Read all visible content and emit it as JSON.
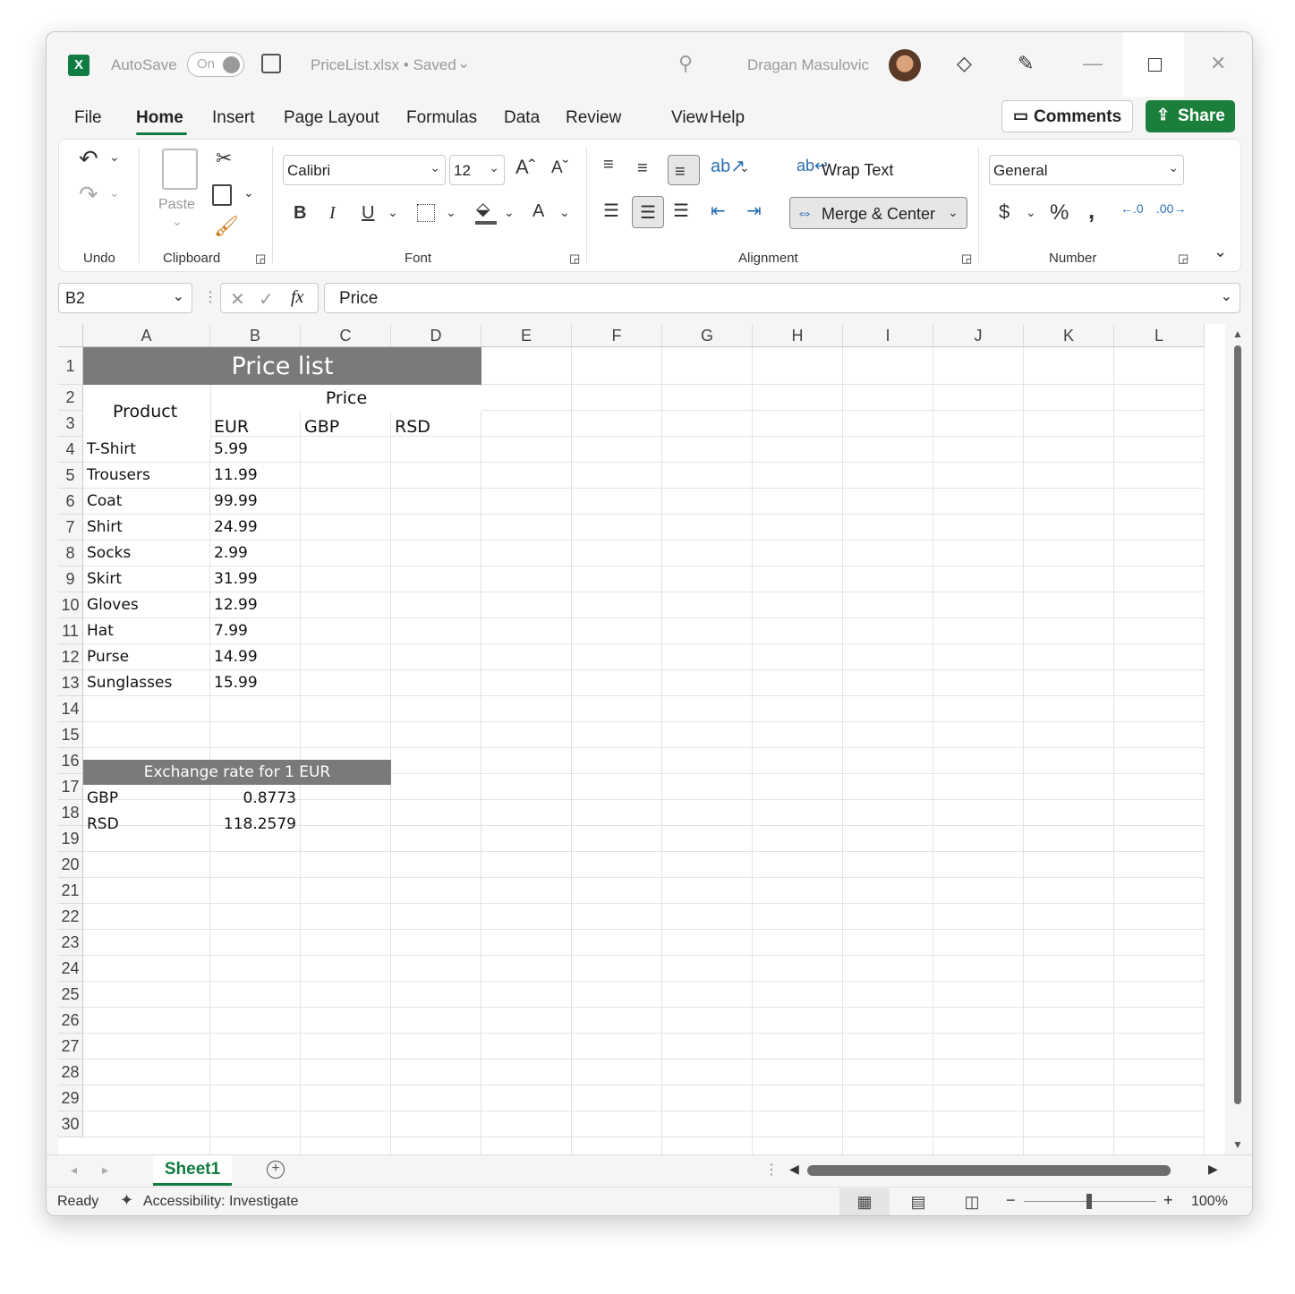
{
  "titlebar": {
    "autosave_label": "AutoSave",
    "autosave_state": "On",
    "filename": "PriceList.xlsx • Saved",
    "user_name": "Dragan Masulovic"
  },
  "menu": {
    "items": [
      "File",
      "Home",
      "Insert",
      "Page Layout",
      "Formulas",
      "Data",
      "Review",
      "View",
      "Help"
    ],
    "comments_label": "Comments",
    "share_label": "Share"
  },
  "ribbon": {
    "groups": [
      "Undo",
      "Clipboard",
      "Font",
      "Alignment",
      "Number"
    ],
    "paste_label": "Paste",
    "font_name": "Calibri",
    "font_size": "12",
    "wrap_text_label": "Wrap Text",
    "merge_center_label": "Merge & Center",
    "number_format": "General"
  },
  "formula_bar": {
    "name_box": "B2",
    "formula": "Price"
  },
  "sheet": {
    "columns": [
      "A",
      "B",
      "C",
      "D",
      "E",
      "F",
      "G",
      "H",
      "I",
      "J",
      "K",
      "L"
    ],
    "rows": [
      "1",
      "2",
      "3",
      "4",
      "5",
      "6",
      "7",
      "8",
      "9",
      "10",
      "11",
      "12",
      "13",
      "14",
      "15",
      "16",
      "17",
      "18",
      "19",
      "20",
      "21",
      "22",
      "23",
      "24",
      "25",
      "26",
      "27",
      "28",
      "29",
      "30"
    ],
    "title": "Price list",
    "product_header": "Product",
    "price_header": "Price",
    "currency_headers": [
      "EUR",
      "GBP",
      "RSD"
    ],
    "products": [
      {
        "name": "T-Shirt",
        "eur": "5.99"
      },
      {
        "name": "Trousers",
        "eur": "11.99"
      },
      {
        "name": "Coat",
        "eur": "99.99"
      },
      {
        "name": "Shirt",
        "eur": "24.99"
      },
      {
        "name": "Socks",
        "eur": "2.99"
      },
      {
        "name": "Skirt",
        "eur": "31.99"
      },
      {
        "name": "Gloves",
        "eur": "12.99"
      },
      {
        "name": "Hat",
        "eur": "7.99"
      },
      {
        "name": "Purse",
        "eur": "14.99"
      },
      {
        "name": "Sunglasses",
        "eur": "15.99"
      }
    ],
    "exchange_header": "Exchange rate for 1 EUR",
    "rates": [
      {
        "currency": "GBP",
        "rate": "0.8773"
      },
      {
        "currency": "RSD",
        "rate": "118.2579"
      }
    ]
  },
  "tabs": {
    "active_sheet": "Sheet1"
  },
  "status": {
    "ready": "Ready",
    "accessibility": "Accessibility: Investigate",
    "zoom": "100%"
  },
  "colors": {
    "excel_green": "#107c41",
    "share_green": "#1b7f3b",
    "title_band": "#7a7a7a"
  }
}
